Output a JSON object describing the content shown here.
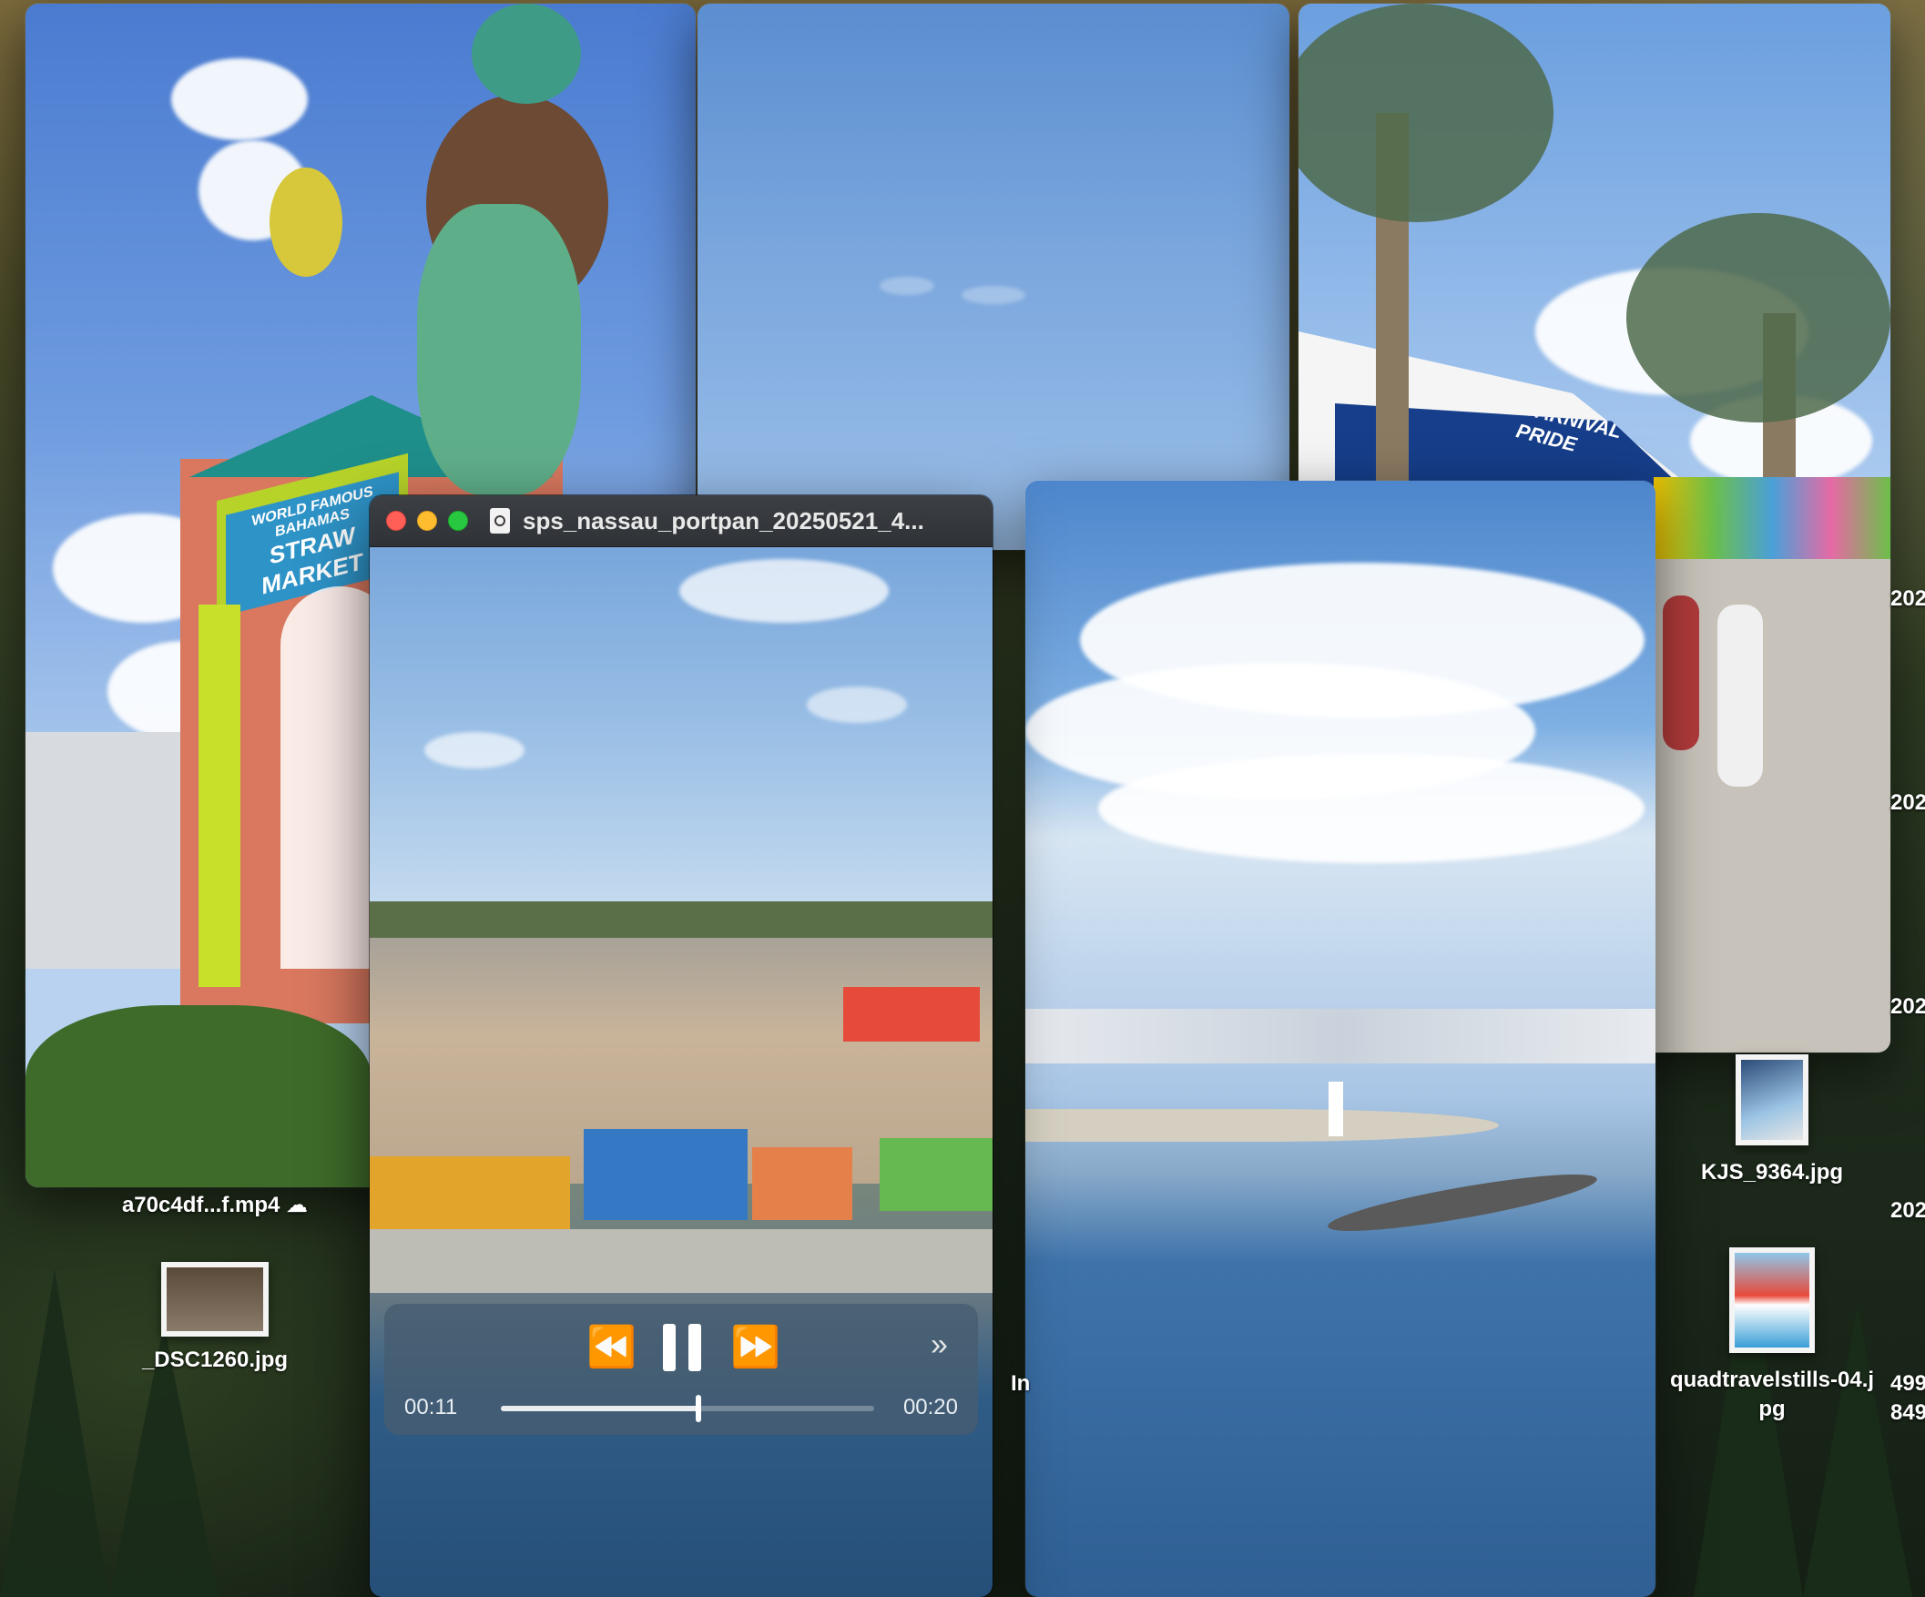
{
  "video_player": {
    "title": "sps_nassau_portpan_20250521_4...",
    "current_time": "00:11",
    "total_time": "00:20",
    "progress": 0.53,
    "icons": {
      "rewind": "rewind-icon",
      "pause": "pause-icon",
      "forward": "fast-forward-icon",
      "skip": "double-chevron-right-icon"
    }
  },
  "desktop_files": [
    {
      "label": "a70c4df...f.mp4",
      "cloud_icon": "☁"
    },
    {
      "label": "_DSC1260.jpg"
    },
    {
      "label": "KJS_9364.jpg"
    },
    {
      "label": "quadtravelstills-04.jpg"
    }
  ],
  "edge_labels": [
    "202",
    "202",
    "202",
    "202",
    "499",
    "849",
    "In"
  ],
  "photo_texts": {
    "market_sign_top": "WORLD FAMOUS BAHAMAS",
    "market_sign": "STRAW MARKET",
    "ship_name": "CARNIVAL PRIDE"
  }
}
